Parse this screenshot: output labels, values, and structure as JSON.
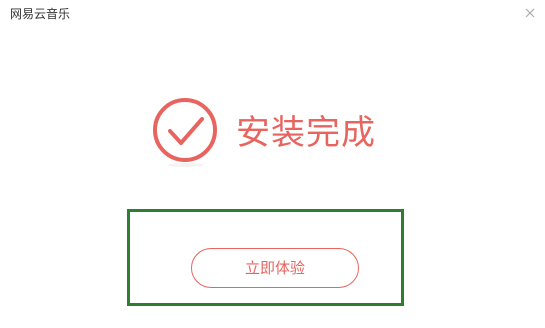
{
  "window": {
    "title": "网易云音乐"
  },
  "status": {
    "message": "安装完成",
    "icon": "check-circle-icon",
    "accent_color": "#e8645f"
  },
  "actions": {
    "primary_label": "立即体验"
  },
  "highlight": {
    "color": "#2e7d32"
  }
}
